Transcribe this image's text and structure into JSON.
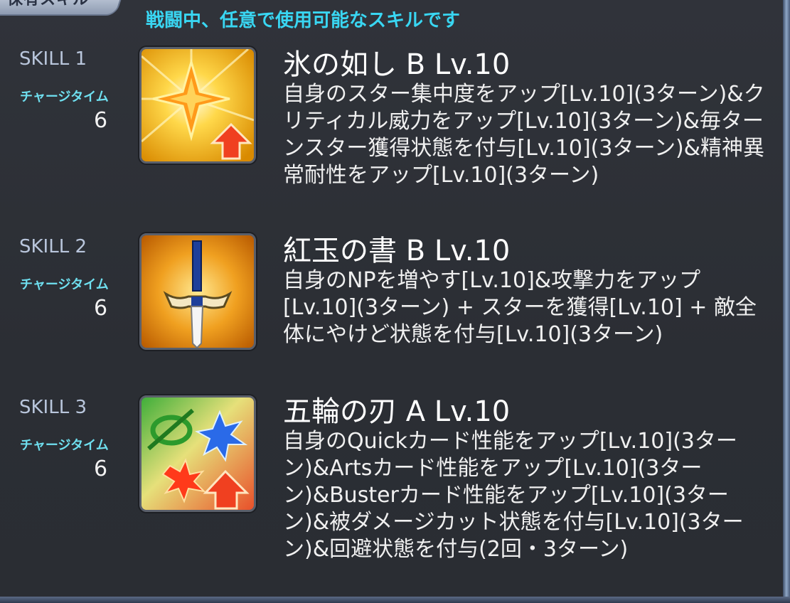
{
  "header": {
    "tab_label": "保有スキル",
    "subtitle": "戦闘中、任意で使用可能なスキルです"
  },
  "skills": [
    {
      "num": "SKILL 1",
      "charge_label": "チャージタイム",
      "charge_value": "6",
      "name": "氷の如し B Lv.10",
      "desc": "自身のスター集中度をアップ[Lv.10](3ターン)&クリティカル威力をアップ[Lv.10](3ターン)&毎ターンスター獲得状態を付与[Lv.10](3ターン)&精神異常耐性をアップ[Lv.10](3ターン)",
      "icon": "star-up-icon"
    },
    {
      "num": "SKILL 2",
      "charge_label": "チャージタイム",
      "charge_value": "6",
      "name": "紅玉の書 B Lv.10",
      "desc": "自身のNPを増やす[Lv.10]&攻撃力をアップ[Lv.10](3ターン) + スターを獲得[Lv.10] + 敵全体にやけど状態を付与[Lv.10](3ターン)",
      "icon": "sword-icon"
    },
    {
      "num": "SKILL 3",
      "charge_label": "チャージタイム",
      "charge_value": "6",
      "name": "五輪の刃 A Lv.10",
      "desc": "自身のQuickカード性能をアップ[Lv.10](3ターン)&Artsカード性能をアップ[Lv.10](3ターン)&Busterカード性能をアップ[Lv.10](3ターン)&被ダメージカット状態を付与[Lv.10](3ターン)&回避状態を付与(2回・3ターン)",
      "icon": "card-up-icon"
    }
  ]
}
